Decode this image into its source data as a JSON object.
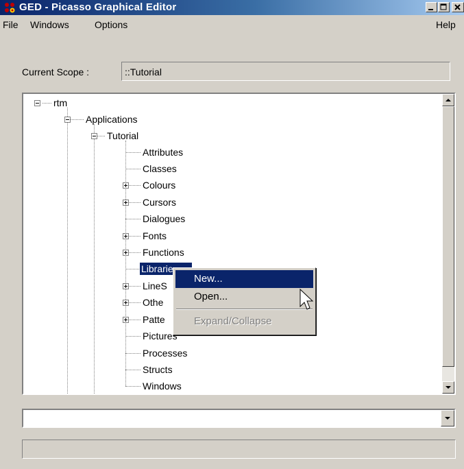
{
  "window": {
    "title": "GED - Picasso Graphical Editor"
  },
  "menubar": {
    "file": "File",
    "windows": "Windows",
    "options": "Options",
    "help": "Help"
  },
  "scope": {
    "label": "Current Scope :",
    "value": "::Tutorial"
  },
  "tree": {
    "root": "rtm",
    "applications": "Applications",
    "tutorial": "Tutorial",
    "children": [
      "Attributes",
      "Classes",
      "Colours",
      "Cursors",
      "Dialogues",
      "Fonts",
      "Functions",
      "Librarie",
      "LineS",
      "Othe",
      "Patte",
      "Pictures",
      "Processes",
      "Structs",
      "Windows"
    ]
  },
  "context_menu": {
    "new": "New...",
    "open": "Open...",
    "expand_collapse": "Expand/Collapse"
  },
  "combo": {
    "value": ""
  },
  "status": {
    "text": ""
  },
  "colors": {
    "title_start": "#0a246a",
    "title_end": "#a6caf0",
    "selection": "#0a246a",
    "face": "#d4d0c8"
  }
}
